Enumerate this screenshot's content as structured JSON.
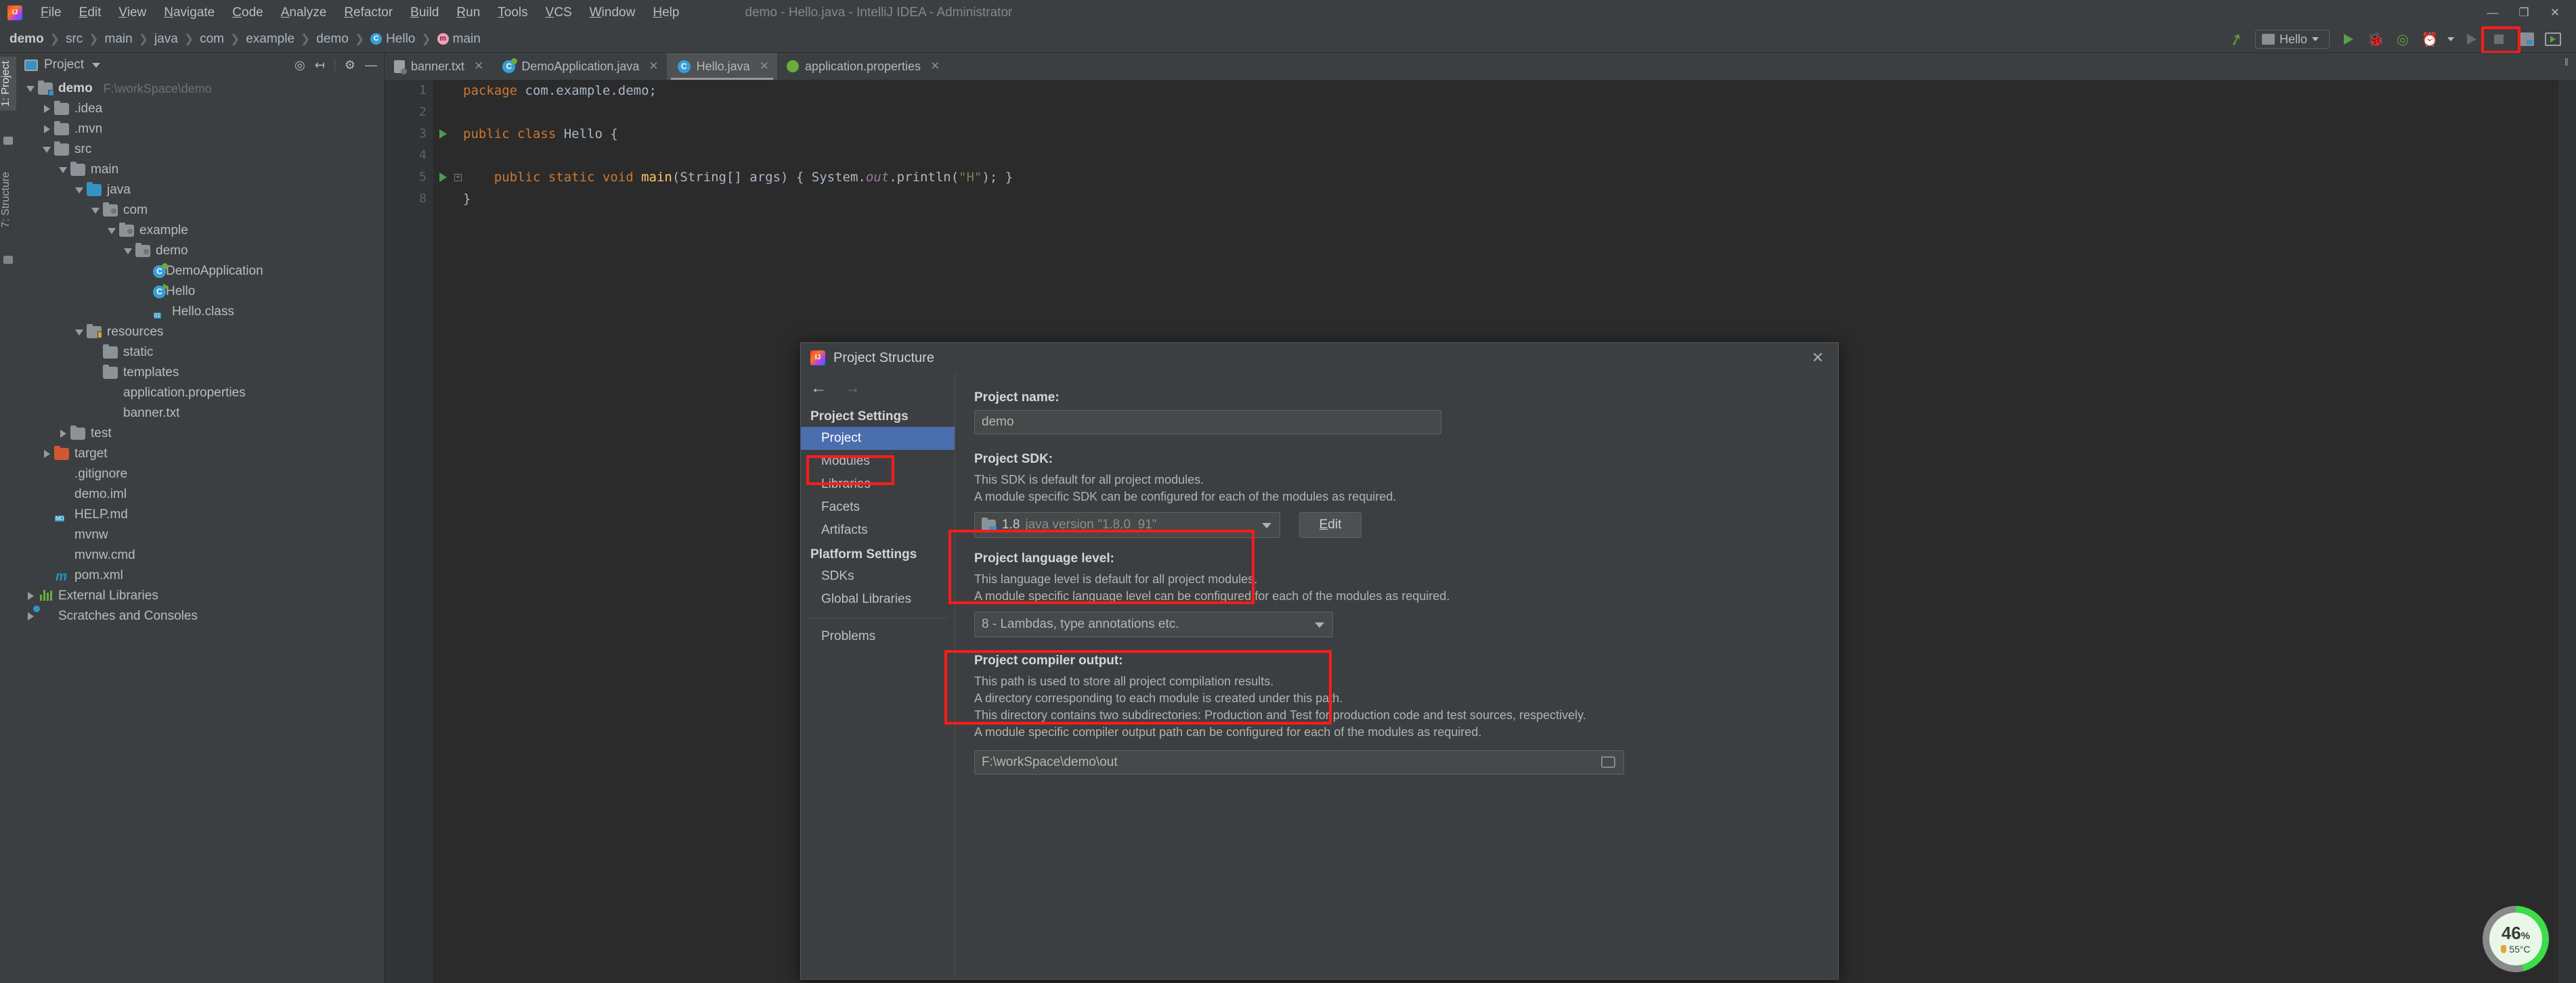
{
  "titlebar": {
    "app_logo": "intellij-logo",
    "menus": [
      "File",
      "Edit",
      "View",
      "Navigate",
      "Code",
      "Analyze",
      "Refactor",
      "Build",
      "Run",
      "Tools",
      "VCS",
      "Window",
      "Help"
    ],
    "window_title": "demo - Hello.java - IntelliJ IDEA - Administrator",
    "minimize": "—",
    "maximize": "❐",
    "close": "✕"
  },
  "breadcrumb": {
    "items": [
      {
        "label": "demo",
        "icon": ""
      },
      {
        "label": "src",
        "icon": ""
      },
      {
        "label": "main",
        "icon": ""
      },
      {
        "label": "java",
        "icon": ""
      },
      {
        "label": "com",
        "icon": ""
      },
      {
        "label": "example",
        "icon": ""
      },
      {
        "label": "demo",
        "icon": ""
      },
      {
        "label": "Hello",
        "icon": "class-icon"
      },
      {
        "label": "main",
        "icon": "method-icon"
      }
    ],
    "separator": "❯"
  },
  "toolbar": {
    "build_icon": "hammer-icon",
    "run_config_name": "Hello",
    "run_icon": "run-icon",
    "debug_icon": "debug-icon",
    "run_coverage_icon": "run-with-coverage-icon",
    "profiler_icon": "profiler-icon",
    "rerun_icon": "rerun-icon",
    "stop_icon": "stop-icon",
    "project_structure_icon": "project-structure-icon",
    "terminal_icon": "terminal-icon",
    "highlight_color": "#ff1b1b"
  },
  "tool_strip": {
    "tabs": [
      {
        "label": "1: Project",
        "accel": "1",
        "active": true
      },
      {
        "label": "7: Structure",
        "accel": "7",
        "active": false
      }
    ]
  },
  "project_panel": {
    "title": "Project",
    "actions": [
      "locate-icon",
      "collapse-all-icon",
      "settings-icon",
      "hide-icon"
    ],
    "tree": [
      {
        "depth": 0,
        "label": "demo",
        "path": "F:\\workSpace\\demo",
        "icon": "module-folder-icon",
        "twisty": "down",
        "bold": true
      },
      {
        "depth": 1,
        "label": ".idea",
        "icon": "folder-icon",
        "twisty": "right"
      },
      {
        "depth": 1,
        "label": ".mvn",
        "icon": "folder-icon",
        "twisty": "right"
      },
      {
        "depth": 1,
        "label": "src",
        "icon": "folder-icon",
        "twisty": "down"
      },
      {
        "depth": 2,
        "label": "main",
        "icon": "folder-icon",
        "twisty": "down"
      },
      {
        "depth": 3,
        "label": "java",
        "icon": "source-folder-icon",
        "twisty": "down"
      },
      {
        "depth": 4,
        "label": "com",
        "icon": "package-icon",
        "twisty": "down"
      },
      {
        "depth": 5,
        "label": "example",
        "icon": "package-icon",
        "twisty": "down"
      },
      {
        "depth": 6,
        "label": "demo",
        "icon": "package-icon",
        "twisty": "down"
      },
      {
        "depth": 7,
        "label": "DemoApplication",
        "icon": "spring-class-icon",
        "twisty": "none"
      },
      {
        "depth": 7,
        "label": "Hello",
        "icon": "runnable-class-icon",
        "twisty": "none"
      },
      {
        "depth": 7,
        "label": "Hello.class",
        "icon": "compiled-class-icon",
        "twisty": "none"
      },
      {
        "depth": 3,
        "label": "resources",
        "icon": "resource-folder-icon",
        "twisty": "down"
      },
      {
        "depth": 4,
        "label": "static",
        "icon": "folder-icon",
        "twisty": "none"
      },
      {
        "depth": 4,
        "label": "templates",
        "icon": "folder-icon",
        "twisty": "none"
      },
      {
        "depth": 4,
        "label": "application.properties",
        "icon": "spring-properties-icon",
        "twisty": "none"
      },
      {
        "depth": 4,
        "label": "banner.txt",
        "icon": "text-file-icon",
        "twisty": "none"
      },
      {
        "depth": 2,
        "label": "test",
        "icon": "folder-icon",
        "twisty": "right"
      },
      {
        "depth": 1,
        "label": "target",
        "icon": "excluded-folder-icon",
        "twisty": "right"
      },
      {
        "depth": 1,
        "label": ".gitignore",
        "icon": "gitignore-file-icon",
        "twisty": "none"
      },
      {
        "depth": 1,
        "label": "demo.iml",
        "icon": "iml-file-icon",
        "twisty": "none"
      },
      {
        "depth": 1,
        "label": "HELP.md",
        "icon": "markdown-file-icon",
        "twisty": "none"
      },
      {
        "depth": 1,
        "label": "mvnw",
        "icon": "shell-file-icon",
        "twisty": "none"
      },
      {
        "depth": 1,
        "label": "mvnw.cmd",
        "icon": "cmd-file-icon",
        "twisty": "none"
      },
      {
        "depth": 1,
        "label": "pom.xml",
        "icon": "maven-file-icon",
        "twisty": "none"
      },
      {
        "depth": 0,
        "label": "External Libraries",
        "icon": "libraries-icon",
        "twisty": "right"
      },
      {
        "depth": 0,
        "label": "Scratches and Consoles",
        "icon": "scratches-icon",
        "twisty": "right"
      }
    ]
  },
  "editor": {
    "tabs": [
      {
        "label": "banner.txt",
        "icon": "text-file-icon",
        "active": false,
        "close": "✕"
      },
      {
        "label": "DemoApplication.java",
        "icon": "spring-class-icon",
        "active": false,
        "close": "✕"
      },
      {
        "label": "Hello.java",
        "icon": "class-icon",
        "active": true,
        "close": "✕"
      },
      {
        "label": "application.properties",
        "icon": "spring-properties-icon",
        "active": false,
        "close": "✕"
      }
    ],
    "line_numbers": [
      "1",
      "2",
      "3",
      "4",
      "5",
      "8"
    ],
    "code_lines": [
      {
        "num": "1",
        "tokens": [
          {
            "t": "package",
            "c": "kw"
          },
          {
            "t": " com.example.demo;",
            "c": ""
          }
        ]
      },
      {
        "num": "2",
        "tokens": []
      },
      {
        "num": "3",
        "gutter": "run-marker",
        "tokens": [
          {
            "t": "public class ",
            "c": "kw"
          },
          {
            "t": "Hello ",
            "c": ""
          },
          {
            "t": "{",
            "c": ""
          }
        ]
      },
      {
        "num": "4",
        "tokens": []
      },
      {
        "num": "5",
        "gutter": "run-marker",
        "fold": "+",
        "tokens": [
          {
            "t": "    public static void ",
            "c": "kw"
          },
          {
            "t": "main",
            "c": "mth"
          },
          {
            "t": "(String[] args) ",
            "c": ""
          },
          {
            "t": "{ System.",
            "c": ""
          },
          {
            "t": "out",
            "c": "fld"
          },
          {
            "t": ".println(",
            "c": ""
          },
          {
            "t": "\"H\"",
            "c": "str"
          },
          {
            "t": "); }",
            "c": ""
          }
        ]
      },
      {
        "num": "8",
        "tokens": [
          {
            "t": "}",
            "c": ""
          }
        ]
      }
    ]
  },
  "dialog": {
    "title": "Project Structure",
    "close_label": "✕",
    "nav_back": "←",
    "nav_forward": "→",
    "sidebar": {
      "project_settings_header": "Project Settings",
      "project_items": [
        "Project",
        "Modules",
        "Libraries",
        "Facets",
        "Artifacts"
      ],
      "platform_settings_header": "Platform Settings",
      "platform_items": [
        "SDKs",
        "Global Libraries"
      ],
      "problems_item": "Problems",
      "selected": "Project"
    },
    "project_name_label": "Project name:",
    "project_name_value": "demo",
    "sdk_label": "Project SDK:",
    "sdk_desc_1": "This SDK is default for all project modules.",
    "sdk_desc_2": "A module specific SDK can be configured for each of the modules as required.",
    "sdk_version": "1.8",
    "sdk_detail": "java version \"1.8.0_91\"",
    "sdk_edit_button": "Edit",
    "language_level_label": "Project language level:",
    "language_level_desc_1": "This language level is default for all project modules.",
    "language_level_desc_2": "A module specific language level can be configured for each of the modules as required.",
    "language_level_value": "8 - Lambdas, type annotations etc.",
    "compiler_output_label": "Project compiler output:",
    "compiler_desc_1": "This path is used to store all project compilation results.",
    "compiler_desc_2": "A directory corresponding to each module is created under this path.",
    "compiler_desc_3": "This directory contains two subdirectories: Production and Test for production code and test sources, respectively.",
    "compiler_desc_4": "A module specific compiler output path can be configured for each of the modules as required.",
    "compiler_output_value": "F:\\workSpace\\demo\\out"
  },
  "cpu_widget": {
    "percent": "46",
    "percent_symbol": "%",
    "temperature": "55°C",
    "ring_color": "#3ddc4a",
    "track_color": "#8a8a8a"
  },
  "scroll_grip": "‖"
}
